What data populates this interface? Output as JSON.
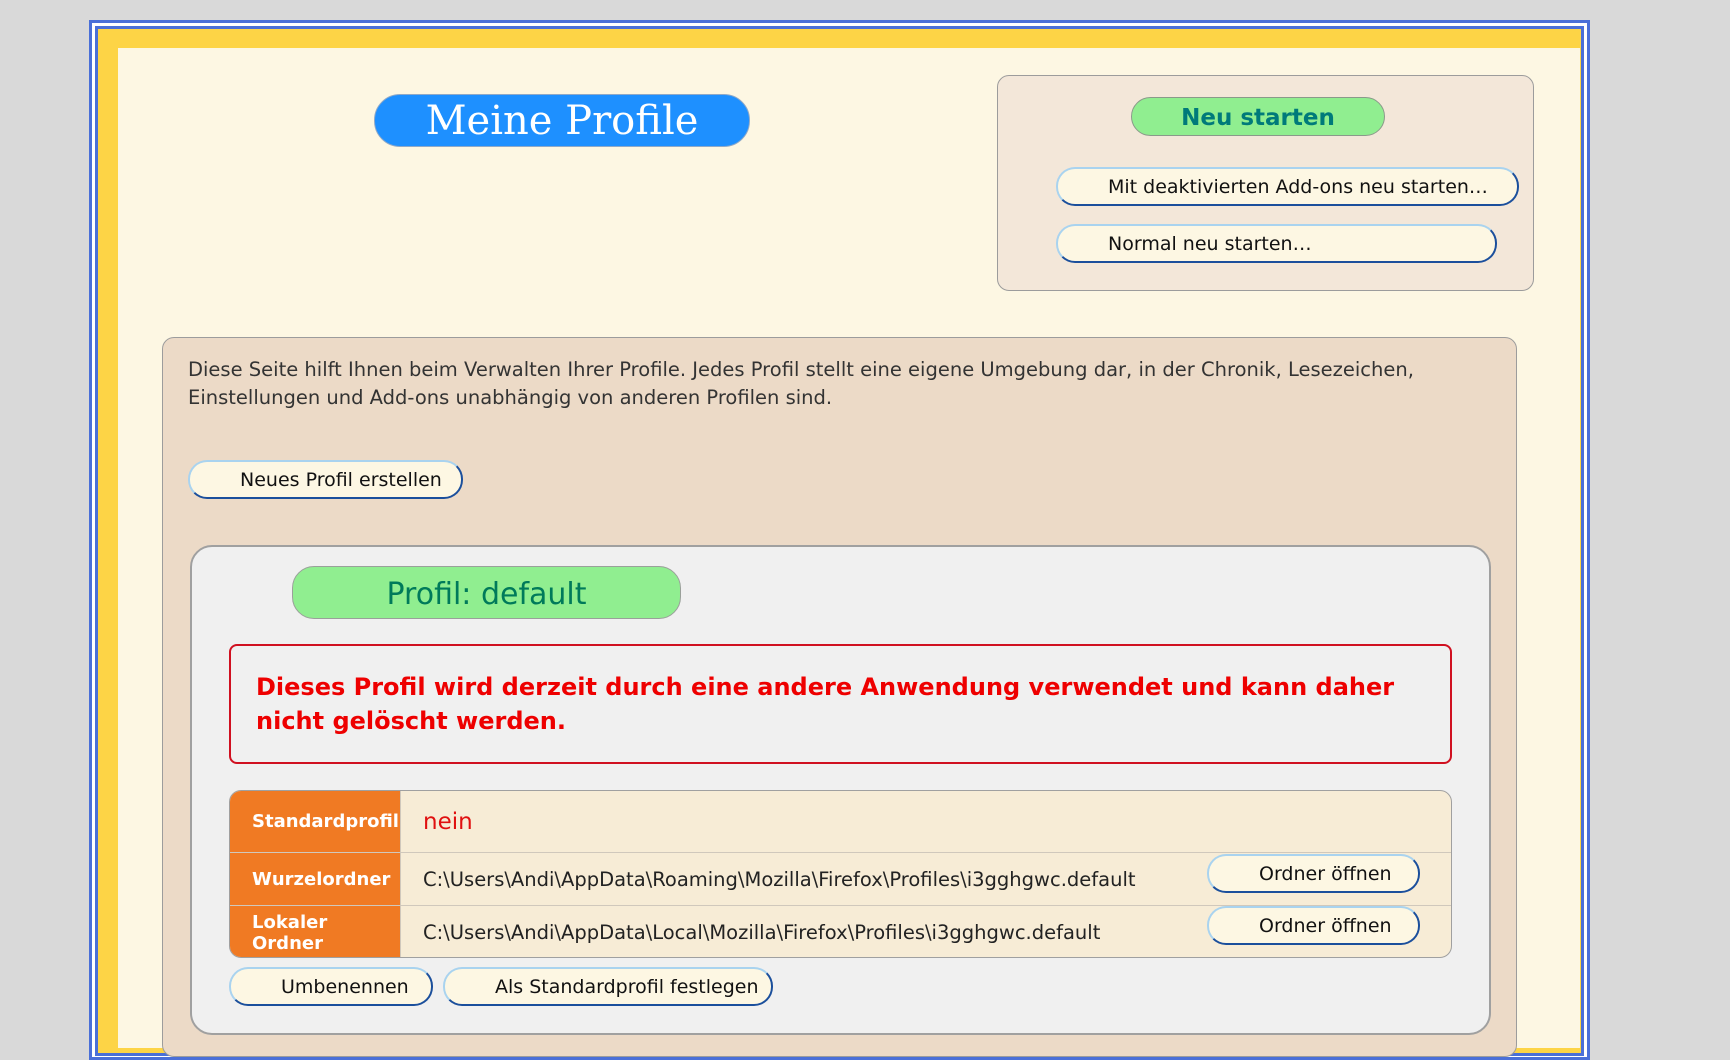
{
  "page": {
    "title": "Meine Profile",
    "description": "Diese Seite hilft Ihnen beim Verwalten Ihrer Profile. Jedes Profil stellt eine eigene Umgebung dar, in der Chronik, Lesezeichen, Einstellungen und Add-ons unabhängig von anderen Profilen sind."
  },
  "restart": {
    "heading": "Neu starten",
    "safe_mode_label": "Mit deaktivierten Add-ons neu starten…",
    "normal_label": "Normal neu starten…"
  },
  "actions": {
    "create_profile_label": "Neues Profil erstellen"
  },
  "profile": {
    "heading": "Profil: default",
    "warning": "Dieses Profil wird derzeit durch eine andere Anwendung verwendet und kann daher nicht gelöscht werden.",
    "rows": [
      {
        "label": "Standardprofil",
        "value": "nein"
      },
      {
        "label": "Wurzelordner",
        "value": "C:\\Users\\Andi\\AppData\\Roaming\\Mozilla\\Firefox\\Profiles\\i3gghgwc.default",
        "button": "Ordner öffnen"
      },
      {
        "label": "Lokaler Ordner",
        "value": "C:\\Users\\Andi\\AppData\\Local\\Mozilla\\Firefox\\Profiles\\i3gghgwc.default",
        "button": "Ordner öffnen"
      }
    ],
    "rename_label": "Umbenennen",
    "set_default_label": "Als Standardprofil festlegen"
  },
  "colors": {
    "title_bg": "#1e90ff",
    "green_pill": "#90ee90",
    "label_orange": "#f07a23",
    "warning_red": "#ee0000",
    "frame_blue": "#4a6fd8",
    "frame_yellow": "#fdd446"
  }
}
